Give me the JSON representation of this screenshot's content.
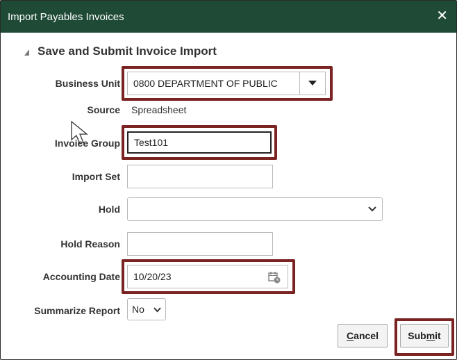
{
  "dialog": {
    "title": "Import Payables Invoices",
    "close_glyph": "✕"
  },
  "section": {
    "title": "Save and Submit Invoice Import"
  },
  "form": {
    "business_unit": {
      "label": "Business Unit",
      "value": "0800 DEPARTMENT OF PUBLIC"
    },
    "source": {
      "label": "Source",
      "value": "Spreadsheet"
    },
    "invoice_group": {
      "label": "Invoice Group",
      "value": "Test101"
    },
    "import_set": {
      "label": "Import Set",
      "value": ""
    },
    "hold": {
      "label": "Hold",
      "value": ""
    },
    "hold_reason": {
      "label": "Hold Reason",
      "value": ""
    },
    "accounting_date": {
      "label": "Accounting Date",
      "value": "10/20/23"
    },
    "summarize_report": {
      "label": "Summarize Report",
      "value": "No"
    }
  },
  "buttons": {
    "cancel": {
      "pre": "",
      "key": "C",
      "post": "ancel"
    },
    "submit": {
      "pre": "Sub",
      "key": "m",
      "post": "it"
    }
  },
  "colors": {
    "title_bar": "#1e4a36",
    "highlight_box": "#7b2323"
  },
  "icons": [
    "close-icon",
    "collapse-triangle-icon",
    "dropdown-arrow-icon",
    "chevron-down-icon",
    "calendar-icon",
    "mouse-pointer-icon"
  ]
}
